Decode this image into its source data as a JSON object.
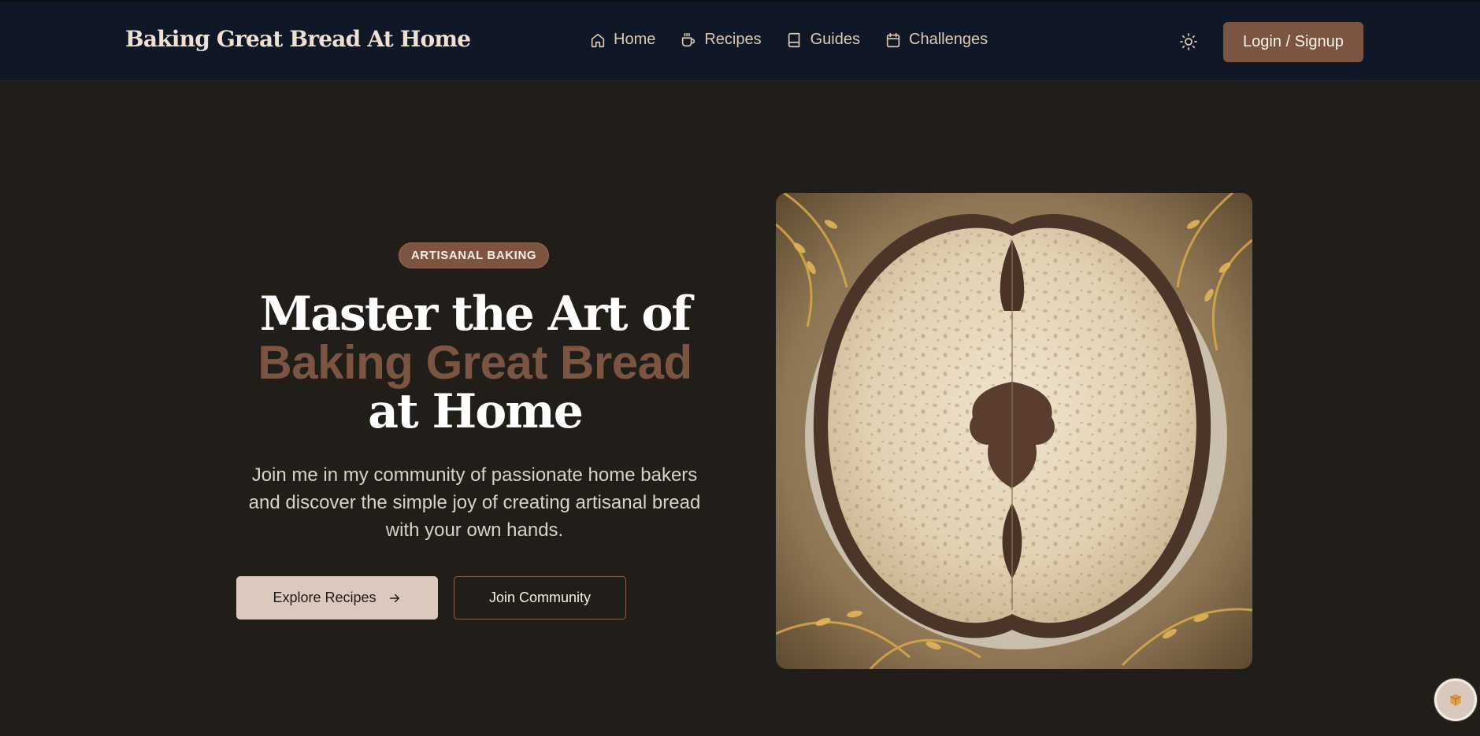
{
  "header": {
    "brand": "Baking Great Bread At Home",
    "nav": [
      {
        "label": "Home",
        "icon": "home-icon"
      },
      {
        "label": "Recipes",
        "icon": "coffee-cup-icon"
      },
      {
        "label": "Guides",
        "icon": "book-icon"
      },
      {
        "label": "Challenges",
        "icon": "calendar-icon"
      }
    ],
    "theme_icon": "sun-icon",
    "login_label": "Login / Signup"
  },
  "hero": {
    "badge": "ARTISANAL BAKING",
    "title_line1": "Master the Art of",
    "title_accent": "Baking Great Bread",
    "title_line3": "at Home",
    "subtitle": "Join me in my community of passionate home bakers and discover the simple joy of creating artisanal bread with your own hands.",
    "cta_primary": "Explore Recipes",
    "cta_primary_icon": "arrow-right-icon",
    "cta_secondary": "Join Community",
    "image": "sliced sourdough bread loaf surrounded by wheat stalks"
  },
  "floating_button": {
    "icon": "box-icon"
  },
  "colors": {
    "header_bg": "#101828",
    "page_bg": "#211e1a",
    "accent": "#7c5542",
    "brand_text": "#ece1d3",
    "nav_text": "#ddc8b4",
    "button_light": "#dcc9be"
  }
}
